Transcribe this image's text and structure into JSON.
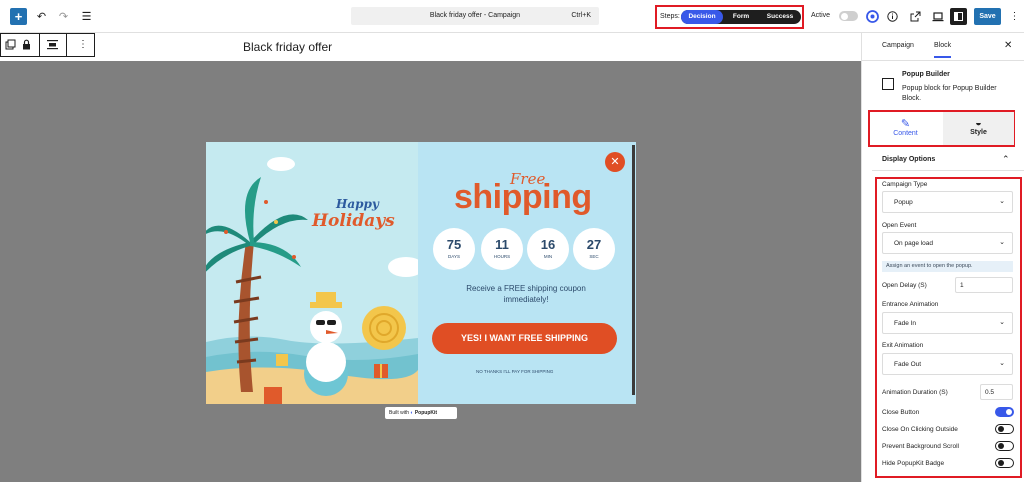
{
  "topbar": {
    "add_icon": "plus-icon",
    "undo_icon": "undo-icon",
    "redo_icon": "redo-icon",
    "list_view_icon": "list-view-icon",
    "document_title": "Black friday offer - Campaign",
    "shortcut": "Ctrl+K",
    "steps_label": "Steps:",
    "steps": [
      "Decision",
      "Form",
      "Success"
    ],
    "active_step": "Decision",
    "active_label": "Active",
    "active_toggle": false,
    "save_label": "Save",
    "colors": {
      "accent": "#3858e9",
      "highlight": "#e01b24",
      "popup_orange": "#e04e24"
    }
  },
  "block_toolbar": {
    "heading": "Black friday offer"
  },
  "popup": {
    "greeting_line1": "Happy",
    "greeting_line2": "Holidays",
    "free_label": "Free",
    "title": "shipping",
    "countdown": [
      {
        "value": "75",
        "unit": "DAYS"
      },
      {
        "value": "11",
        "unit": "HOURS"
      },
      {
        "value": "16",
        "unit": "MIN"
      },
      {
        "value": "27",
        "unit": "SEC"
      }
    ],
    "coupon_text": "Receive a FREE shipping coupon immediately!",
    "cta_label": "YES! I WANT FREE SHIPPING",
    "decline_label": "NO THANKS I'LL PAY FOR SHIPPING",
    "close_icon": "close-icon",
    "built_with_prefix": "Built with",
    "built_with_brand": "PopupKit"
  },
  "sidebar": {
    "tabs": [
      "Campaign",
      "Block"
    ],
    "active_tab": "Block",
    "block_title": "Popup Builder",
    "block_desc": "Popup block for Popup Builder Block.",
    "content_tab": "Content",
    "style_tab": "Style",
    "section_title": "Display Options",
    "campaign_type_label": "Campaign Type",
    "campaign_type_value": "Popup",
    "open_event_label": "Open Event",
    "open_event_value": "On page load",
    "open_event_help": "Assign an event to open the popup.",
    "open_delay_label": "Open Delay (S)",
    "open_delay_value": "1",
    "entrance_label": "Entrance Animation",
    "entrance_value": "Fade In",
    "exit_label": "Exit Animation",
    "exit_value": "Fade Out",
    "duration_label": "Animation Duration (S)",
    "duration_value": "0.5",
    "toggles": [
      {
        "label": "Close Button",
        "on": true
      },
      {
        "label": "Close On Clicking Outside",
        "on": false
      },
      {
        "label": "Prevent Background Scroll",
        "on": false
      },
      {
        "label": "Hide PopupKit Badge",
        "on": false
      }
    ]
  }
}
